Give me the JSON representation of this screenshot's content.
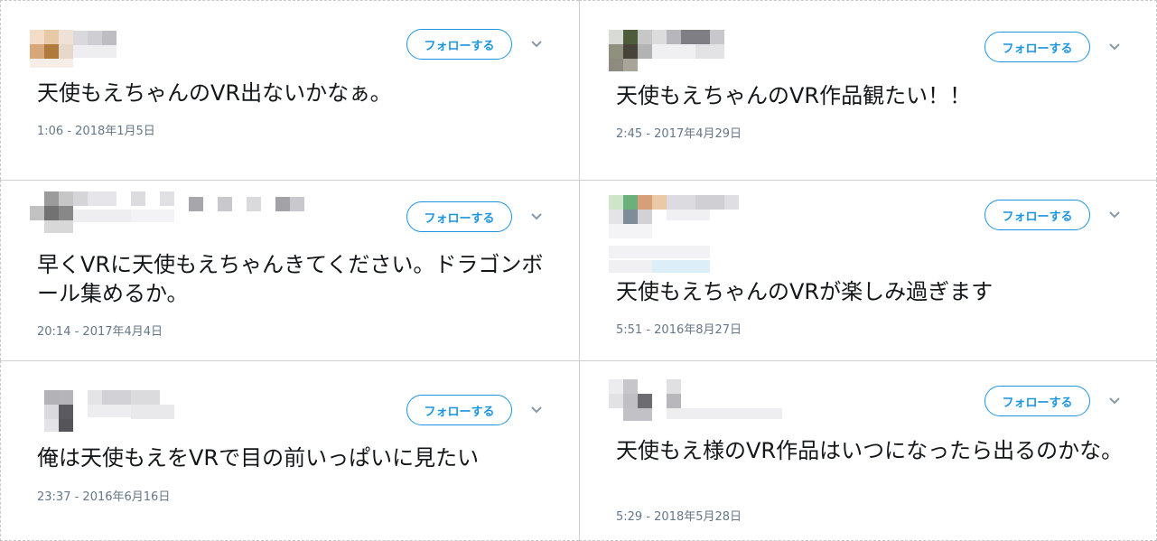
{
  "follow_label": "フォローする",
  "tweets": [
    {
      "text": "天使もえちゃんのVR出ないかなぁ。",
      "timestamp": "1:06 - 2018年1月5日"
    },
    {
      "text": "天使もえちゃんのVR作品観たい！！",
      "timestamp": "2:45 - 2017年4月29日"
    },
    {
      "text": "早くVRに天使もえちゃんきてください。ドラゴンボール集めるか。",
      "timestamp": "20:14 - 2017年4月4日"
    },
    {
      "text": "天使もえちゃんのVRが楽しみ過ぎます",
      "timestamp": "5:51 - 2016年8月27日"
    },
    {
      "text": "俺は天使もえをVRで目の前いっぱいに見たい",
      "timestamp": "23:37 - 2016年6月16日"
    },
    {
      "text": "天使もえ様のVR作品はいつになったら出るのかな。",
      "timestamp": "5:29 - 2018年5月28日"
    }
  ],
  "icons": {
    "dropdown": "chevron-down-icon"
  },
  "colors": {
    "accent": "#1b95e0",
    "timestamp": "#657786",
    "text": "#14171a"
  }
}
